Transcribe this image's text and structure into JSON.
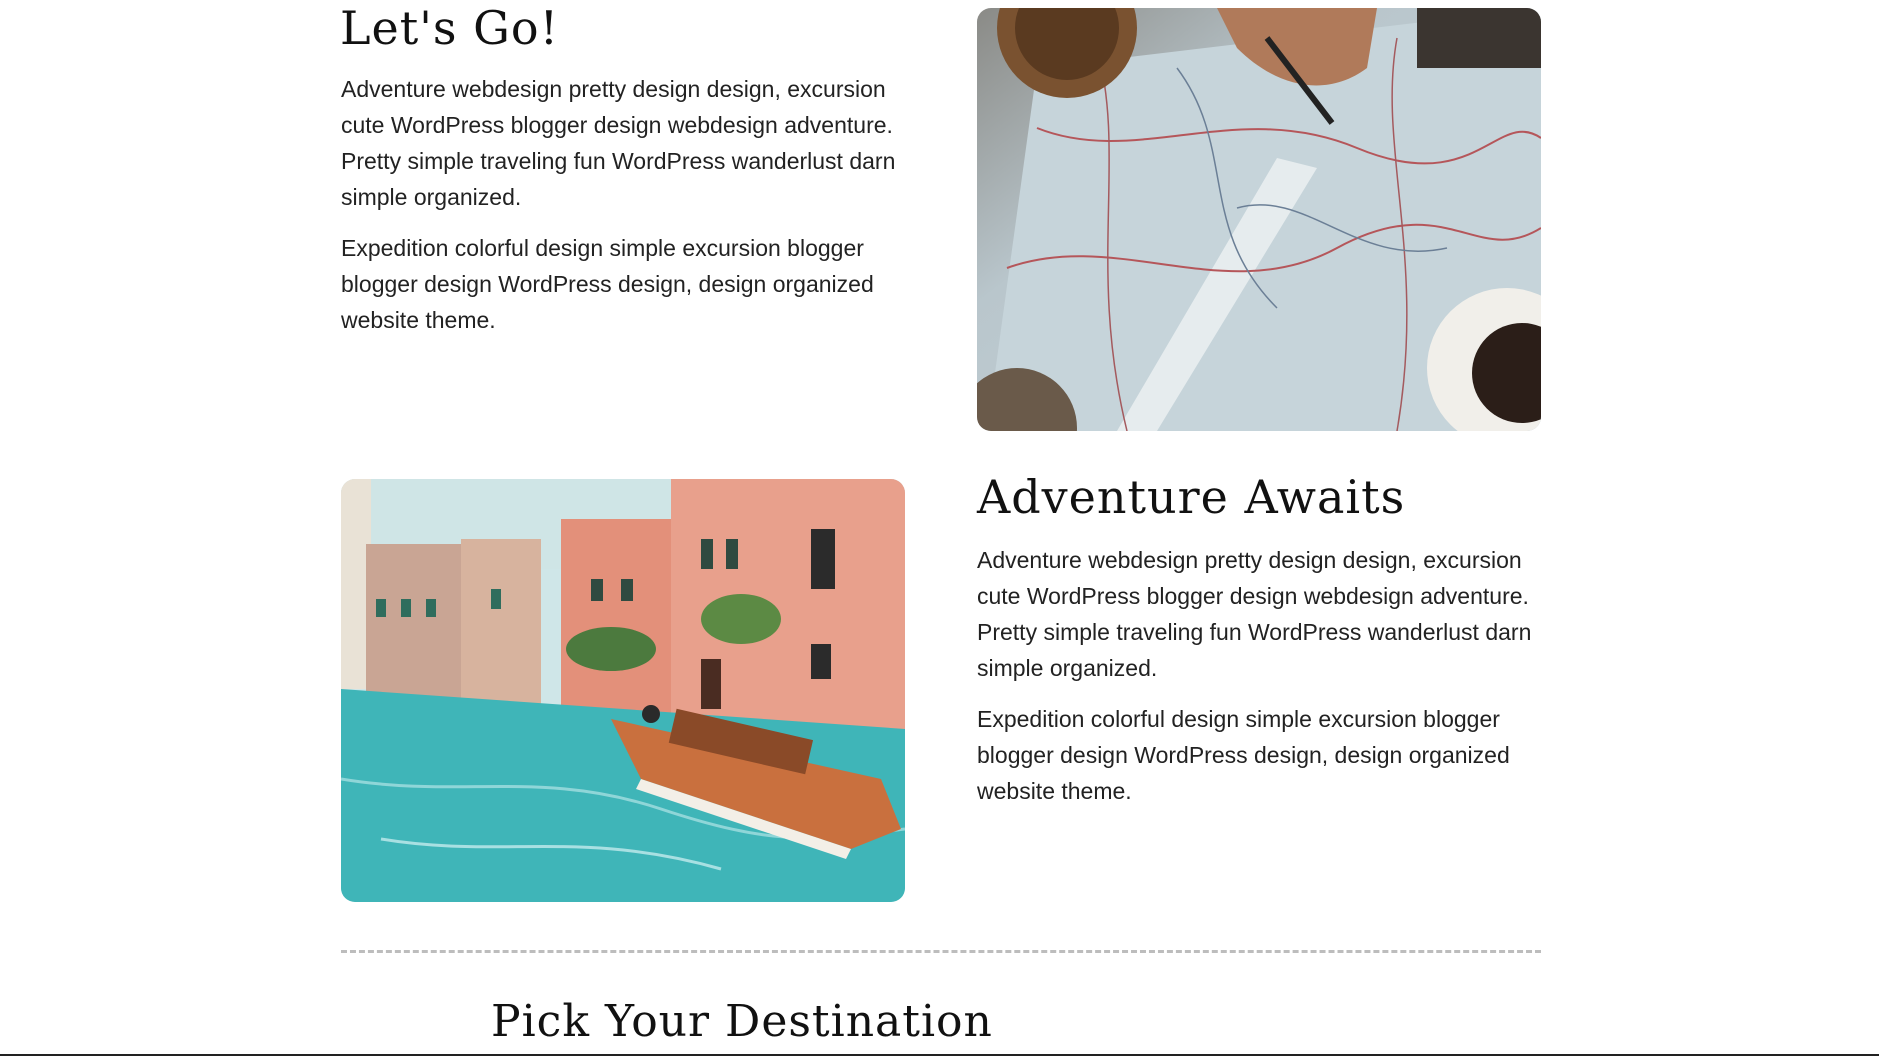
{
  "sections": [
    {
      "heading": "Let's Go!",
      "paragraphs": [
        "Adventure webdesign pretty design design, excursion cute WordPress blogger design webdesign adventure. Pretty simple traveling fun WordPress wanderlust darn simple organized.",
        "Expedition colorful design simple excursion blogger blogger design WordPress design, design organized website theme."
      ],
      "image_icon": "map-photo"
    },
    {
      "heading": "Adventure Awaits",
      "paragraphs": [
        "Adventure webdesign pretty design design, excursion cute WordPress blogger design webdesign adventure. Pretty simple traveling fun WordPress wanderlust darn simple organized.",
        "Expedition colorful design simple excursion blogger blogger design WordPress design, design organized website theme."
      ],
      "image_icon": "venice-canal-photo"
    }
  ],
  "destination": {
    "heading": "Pick Your Destination"
  },
  "colors": {
    "text": "#222222",
    "divider": "#bdbdbd",
    "water": "#3fb5b8",
    "building": "#e0907a",
    "map": "#b8c9d3"
  }
}
